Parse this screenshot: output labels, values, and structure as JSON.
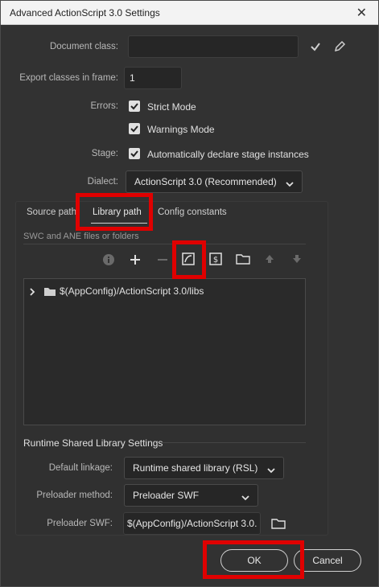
{
  "window": {
    "title": "Advanced ActionScript 3.0 Settings"
  },
  "form": {
    "document_class_label": "Document class:",
    "document_class_value": "",
    "export_frame_label": "Export classes in frame:",
    "export_frame_value": "1",
    "errors_label": "Errors:",
    "strict_mode_label": "Strict Mode",
    "warnings_mode_label": "Warnings Mode",
    "stage_label": "Stage:",
    "auto_declare_label": "Automatically declare stage instances",
    "dialect_label": "Dialect:",
    "dialect_value": "ActionScript 3.0 (Recommended)"
  },
  "tabs": {
    "source_path": "Source path",
    "library_path": "Library path",
    "config_constants": "Config constants"
  },
  "library": {
    "section_label": "SWC and ANE files or folders",
    "entries": [
      {
        "path": "$(AppConfig)/ActionScript 3.0/libs"
      }
    ]
  },
  "rsl": {
    "section_label": "Runtime Shared Library Settings",
    "default_linkage_label": "Default linkage:",
    "default_linkage_value": "Runtime shared library (RSL)",
    "preloader_method_label": "Preloader method:",
    "preloader_method_value": "Preloader SWF",
    "preloader_swf_label": "Preloader SWF:",
    "preloader_swf_value": "$(AppConfig)/ActionScript 3.0."
  },
  "buttons": {
    "ok": "OK",
    "cancel": "Cancel"
  },
  "colors": {
    "highlight": "#e00000",
    "panel_bg": "#323232"
  }
}
